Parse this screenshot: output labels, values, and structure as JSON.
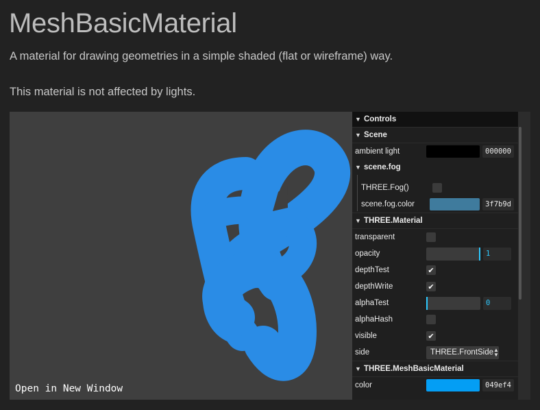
{
  "page": {
    "title": "MeshBasicMaterial",
    "description_1": "A material for drawing geometries in a simple shaded (flat or wireframe) way.",
    "description_2": "This material is not affected by lights."
  },
  "viewport": {
    "background": "#3f3f3f",
    "mesh_color": "#2a8ce6",
    "open_link": "Open in New Window"
  },
  "gui": {
    "root_title": "Controls",
    "scene": {
      "title": "Scene",
      "ambient_light": {
        "label": "ambient light",
        "color": "#000000",
        "hex": "000000"
      },
      "fog": {
        "title": "scene.fog",
        "fog_toggle": {
          "label": "THREE.Fog()",
          "checked": false
        },
        "fog_color": {
          "label": "scene.fog.color",
          "color": "#3f7b9d",
          "hex": "3f7b9d"
        }
      }
    },
    "material": {
      "title": "THREE.Material",
      "transparent": {
        "label": "transparent",
        "checked": false
      },
      "opacity": {
        "label": "opacity",
        "value": "1",
        "fraction": 1
      },
      "depthTest": {
        "label": "depthTest",
        "checked": true
      },
      "depthWrite": {
        "label": "depthWrite",
        "checked": true
      },
      "alphaTest": {
        "label": "alphaTest",
        "value": "0",
        "fraction": 0
      },
      "alphaHash": {
        "label": "alphaHash",
        "checked": false
      },
      "visible": {
        "label": "visible",
        "checked": true
      },
      "side": {
        "label": "side",
        "value": "THREE.FrontSide"
      }
    },
    "basic": {
      "title": "THREE.MeshBasicMaterial",
      "color": {
        "label": "color",
        "color": "#049ef4",
        "hex": "049ef4"
      }
    }
  },
  "icons": {
    "folder_open": "chevron-down-icon",
    "checkmark": "check-icon",
    "select_arrows": "updown-arrows-icon"
  }
}
